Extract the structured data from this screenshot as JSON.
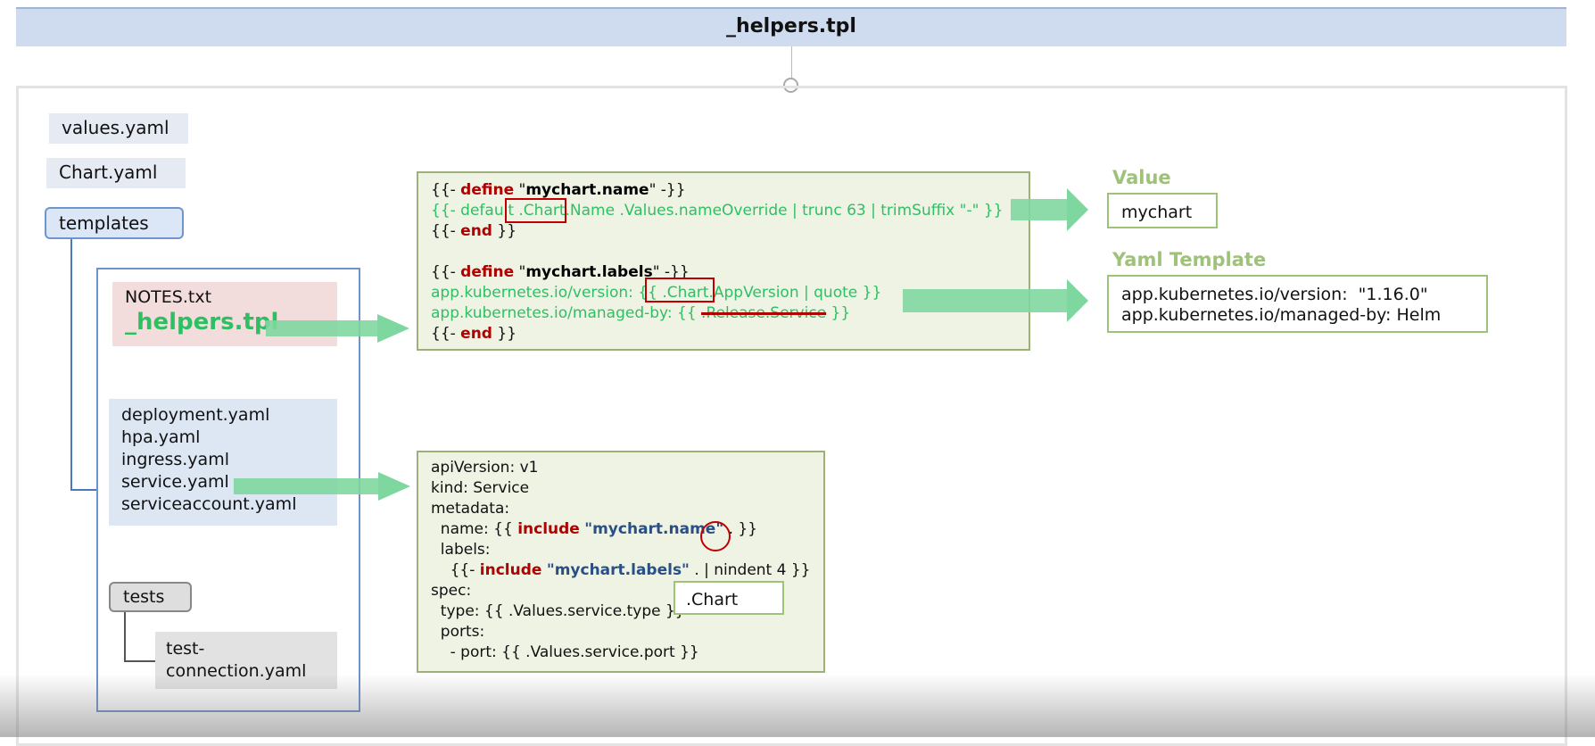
{
  "header": {
    "title": "_helpers.tpl"
  },
  "tree": {
    "values_yaml": "values.yaml",
    "chart_yaml": "Chart.yaml",
    "templates": "templates",
    "notes_txt": "NOTES.txt",
    "helpers_tpl": "_helpers.tpl",
    "yaml_files": [
      "deployment.yaml",
      "hpa.yaml",
      "ingress.yaml",
      "service.yaml",
      "serviceaccount.yaml"
    ],
    "tests": "tests",
    "test_connection": [
      "test-",
      "connection.yaml"
    ]
  },
  "helpers_code": {
    "l1": {
      "a": "{{- ",
      "kw": "define",
      "b": " \"",
      "nm": "mychart.name",
      "c": "\" -}}"
    },
    "l2": {
      "a": "{{- default ",
      "b": ".Chart.",
      "c": "Name .Values.nameOverride | trunc 63 | trimSuffix \"-\" }}"
    },
    "l3": {
      "a": "{{- ",
      "kw": "end",
      "b": " }}"
    },
    "l4": {
      "a": "{{- ",
      "kw": "define",
      "b": " \"",
      "nm": "mychart.labels",
      "c": "\" -}}"
    },
    "l5": {
      "a": "app.kubernetes.io/version: {{ ",
      "b": ".Chart.",
      "c": "AppVersion | quote }}"
    },
    "l6": {
      "a": "app.kubernetes.io/managed-by: {{ ",
      "strike": ".Release.Service",
      "c": " }}"
    },
    "l7": {
      "a": "{{- ",
      "kw": "end",
      "b": " }}"
    }
  },
  "service_code": {
    "l1": "apiVersion: v1",
    "l2": "kind: Service",
    "l3": "metadata:",
    "l4": {
      "a": "  name: {{ ",
      "kw": "include",
      "b": " ",
      "nm": "\"mychart.name\"",
      "c": " . }}"
    },
    "l5": "  labels:",
    "l6": {
      "a": "    {{- ",
      "kw": "include",
      "b": " ",
      "nm": "\"mychart.labels\"",
      "c": " . | nindent 4 }}"
    },
    "l7": "spec:",
    "l8": "  type: {{ .Values.service.type }}",
    "l9": "  ports:",
    "l10": "    - port: {{ .Values.service.port }}"
  },
  "chart_popup": ".Chart",
  "value_section": {
    "label": "Value",
    "result": "mychart"
  },
  "yaml_section": {
    "label": "Yaml Template",
    "lines": [
      "app.kubernetes.io/version:  \"1.16.0\"",
      "app.kubernetes.io/managed-by: Helm"
    ]
  },
  "colors": {
    "highlight_green": "#2fbf63",
    "keyword_red": "#b00000",
    "arrow_green": "#7fd7a0",
    "label_green": "#9fc27a"
  }
}
